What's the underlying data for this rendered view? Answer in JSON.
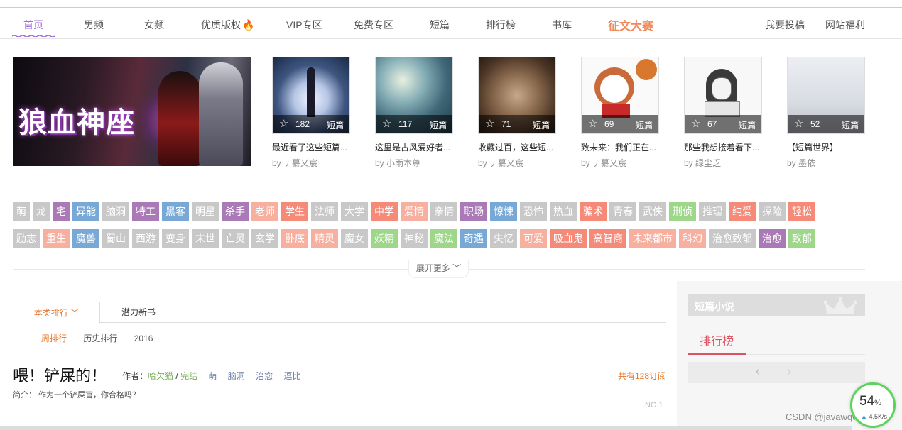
{
  "nav": {
    "items": [
      "首页",
      "男频",
      "女频",
      "优质版权",
      "VIP专区",
      "免费专区",
      "短篇",
      "排行榜",
      "书库"
    ],
    "contest": "征文大赛",
    "right": [
      "我要投稿",
      "网站福利"
    ],
    "active_color": "#a06cd5"
  },
  "banner": {
    "title": "狼血神座"
  },
  "cards": [
    {
      "count": "182",
      "type": "短篇",
      "title": "最近看了这些短篇...",
      "author": "by 丿慕乂宸"
    },
    {
      "count": "117",
      "type": "短篇",
      "title": "这里是古风爱好者...",
      "author": "by 小雨本尊"
    },
    {
      "count": "71",
      "type": "短篇",
      "title": "收藏过百，这些短...",
      "author": "by 丿慕乂宸"
    },
    {
      "count": "69",
      "type": "短篇",
      "title": "致未来：我们正在...",
      "author": "by 丿慕乂宸"
    },
    {
      "count": "67",
      "type": "短篇",
      "title": "那些我想接着看下...",
      "author": "by 绿尘乏"
    },
    {
      "count": "52",
      "type": "短篇",
      "title": "【短篇世界】",
      "author": "by 墨依"
    }
  ],
  "tags": {
    "row1": [
      {
        "t": "萌",
        "c": "#c8c8c8"
      },
      {
        "t": "龙",
        "c": "#c8c8c8"
      },
      {
        "t": "宅",
        "c": "#a97ab6"
      },
      {
        "t": "异能",
        "c": "#78a8d6"
      },
      {
        "t": "脑洞",
        "c": "#c8c8c8"
      },
      {
        "t": "特工",
        "c": "#a97ab6"
      },
      {
        "t": "黑客",
        "c": "#78a8d6"
      },
      {
        "t": "明星",
        "c": "#c8c8c8"
      },
      {
        "t": "杀手",
        "c": "#a97ab6"
      },
      {
        "t": "老师",
        "c": "#f7b0a0"
      },
      {
        "t": "学生",
        "c": "#f58a78"
      },
      {
        "t": "法师",
        "c": "#c8c8c8"
      },
      {
        "t": "大学",
        "c": "#c8c8c8"
      },
      {
        "t": "中学",
        "c": "#f58a78"
      },
      {
        "t": "爱情",
        "c": "#f7b0a0"
      },
      {
        "t": "亲情",
        "c": "#c8c8c8"
      },
      {
        "t": "职场",
        "c": "#a97ab6"
      },
      {
        "t": "惊悚",
        "c": "#78a8d6"
      },
      {
        "t": "恐怖",
        "c": "#c8c8c8"
      },
      {
        "t": "热血",
        "c": "#c8c8c8"
      },
      {
        "t": "骗术",
        "c": "#f58a78"
      },
      {
        "t": "青春",
        "c": "#c8c8c8"
      },
      {
        "t": "武侠",
        "c": "#c8c8c8"
      },
      {
        "t": "刑侦",
        "c": "#9ed68a"
      },
      {
        "t": "推理",
        "c": "#c8c8c8"
      },
      {
        "t": "纯爱",
        "c": "#f58a78"
      },
      {
        "t": "探险",
        "c": "#c8c8c8"
      },
      {
        "t": "轻松",
        "c": "#f58a78"
      }
    ],
    "row2": [
      {
        "t": "励志",
        "c": "#c8c8c8"
      },
      {
        "t": "重生",
        "c": "#f7b0a0"
      },
      {
        "t": "魔兽",
        "c": "#78a8d6"
      },
      {
        "t": "蜀山",
        "c": "#c8c8c8"
      },
      {
        "t": "西游",
        "c": "#c8c8c8"
      },
      {
        "t": "变身",
        "c": "#c8c8c8"
      },
      {
        "t": "末世",
        "c": "#c8c8c8"
      },
      {
        "t": "亡灵",
        "c": "#c8c8c8"
      },
      {
        "t": "玄学",
        "c": "#c8c8c8"
      },
      {
        "t": "卧底",
        "c": "#f7b0a0"
      },
      {
        "t": "精灵",
        "c": "#f7b0a0"
      },
      {
        "t": "魔女",
        "c": "#c8c8c8"
      },
      {
        "t": "妖精",
        "c": "#9ed68a"
      },
      {
        "t": "神秘",
        "c": "#c8c8c8"
      },
      {
        "t": "魔法",
        "c": "#9ed68a"
      },
      {
        "t": "奇遇",
        "c": "#78a8d6"
      },
      {
        "t": "失忆",
        "c": "#c8c8c8"
      },
      {
        "t": "可爱",
        "c": "#f7b0a0"
      },
      {
        "t": "吸血鬼",
        "c": "#f58a78"
      },
      {
        "t": "高智商",
        "c": "#f58a78"
      },
      {
        "t": "未来都市",
        "c": "#f7b0a0"
      },
      {
        "t": "科幻",
        "c": "#f7b0a0"
      },
      {
        "t": "治愈致郁",
        "c": "#c8c8c8"
      },
      {
        "t": "治愈",
        "c": "#a97ab6"
      },
      {
        "t": "致郁",
        "c": "#9ed68a"
      }
    ]
  },
  "expand_label": "展开更多",
  "ranking": {
    "tabs": [
      "本类排行",
      "潜力新书"
    ],
    "subtabs": [
      "一周排行",
      "历史排行",
      "2016"
    ],
    "book": {
      "title": "喂！铲屎的！",
      "author_label": "作者：",
      "author": "哈欠猫",
      "separator": "/",
      "status": "完结",
      "tags": [
        "萌",
        "脑洞",
        "治愈",
        "逗比"
      ],
      "subscriptions": "共有128订阅",
      "intro": "简介： 作为一个铲屎官，你合格吗？",
      "rank": "NO.1"
    }
  },
  "sidebar": {
    "title": "短篇小说",
    "rank_label": "排行榜",
    "prev": "‹",
    "next": "›"
  },
  "widget": {
    "percent": "54",
    "unit": "%",
    "rate": "4.5K/s"
  },
  "watermark": "CSDN @javawqw821"
}
